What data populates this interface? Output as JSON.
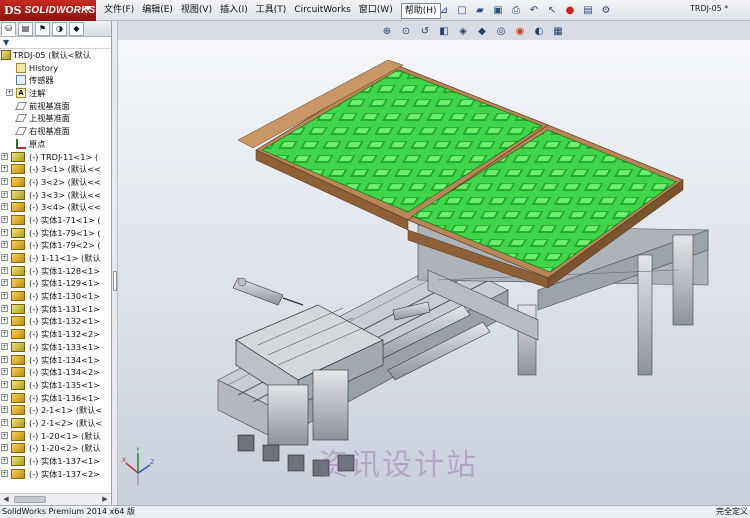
{
  "app": {
    "brand": "SOLIDWORKS",
    "brand_mark": "DS",
    "document_title": "TRDJ-05 *"
  },
  "menu": [
    "文件(F)",
    "编辑(E)",
    "视图(V)",
    "插入(I)",
    "工具(T)",
    "CircuitWorks",
    "窗口(W)",
    "帮助(H)"
  ],
  "quick_access": [
    "pin-icon",
    "new-icon",
    "open-icon",
    "save-icon",
    "print-icon",
    "undo-icon",
    "select-icon",
    "rebuild-icon",
    "file-properties-icon",
    "options-icon"
  ],
  "view_toolbar": [
    "zoom-to-fit-icon",
    "zoom-area-icon",
    "previous-view-icon",
    "section-view-icon",
    "view-orientation-icon",
    "display-style-icon",
    "hide-show-items-icon",
    "edit-appearance-icon",
    "apply-scene-icon",
    "view-settings-icon"
  ],
  "feature_tree": {
    "panel_tabs": [
      "feature-manager-icon",
      "property-manager-icon",
      "configuration-manager-icon",
      "display-manager-icon",
      "cam-manager-icon"
    ],
    "filter_icon": "filter-icon",
    "root": "TRDJ-05 (默认<默认",
    "items": [
      {
        "label": "History",
        "icon": "history-icon"
      },
      {
        "label": "传感器",
        "icon": "sensors-icon"
      },
      {
        "label": "注解",
        "icon": "annotations-icon",
        "expandable": true
      },
      {
        "label": "前视基准面",
        "icon": "plane-icon"
      },
      {
        "label": "上视基准面",
        "icon": "plane-icon"
      },
      {
        "label": "右视基准面",
        "icon": "plane-icon"
      },
      {
        "label": "原点",
        "icon": "origin-icon"
      }
    ],
    "components": [
      "(-) TRDJ-11<1> (",
      "(-) 3<1> (默认<<",
      "(-) 3<2> (默认<<",
      "(-) 3<3> (默认<<",
      "(-) 3<4> (默认<<",
      "(-) 实体1-71<1> (",
      "(-) 实体1-79<1> (",
      "(-) 实体1-79<2> (",
      "(-) 1-11<1> (默认",
      "(-) 实体1-128<1>",
      "(-) 实体1-129<1>",
      "(-) 实体1-130<1>",
      "(-) 实体1-131<1>",
      "(-) 实体1-132<1>",
      "(-) 实体1-132<2>",
      "(-) 实体1-133<1>",
      "(-) 实体1-134<1>",
      "(-) 实体1-134<2>",
      "(-) 实体1-135<1>",
      "(-) 实体1-136<1>",
      "(-) 2-1<1> (默认<",
      "(-) 2-1<2> (默认<",
      "(-) 1-20<1> (默认",
      "(-) 1-20<2> (默认",
      "(-) 实体1-137<1>",
      "(-) 实体1-137<2>"
    ]
  },
  "viewport": {
    "watermark": "资讯设计站",
    "triad": {
      "x_label": "X",
      "y_label": "Y",
      "z_label": "Z"
    },
    "colors": {
      "tray_green": "#3fd64a",
      "frame_tan": "#b88654",
      "steel": "#b9bec6",
      "background_top": "#f5f7fa",
      "background_bottom": "#c9d0da"
    }
  },
  "status_bar": {
    "left": "SolidWorks Premium 2014 x64 版",
    "right": "完全定义"
  }
}
